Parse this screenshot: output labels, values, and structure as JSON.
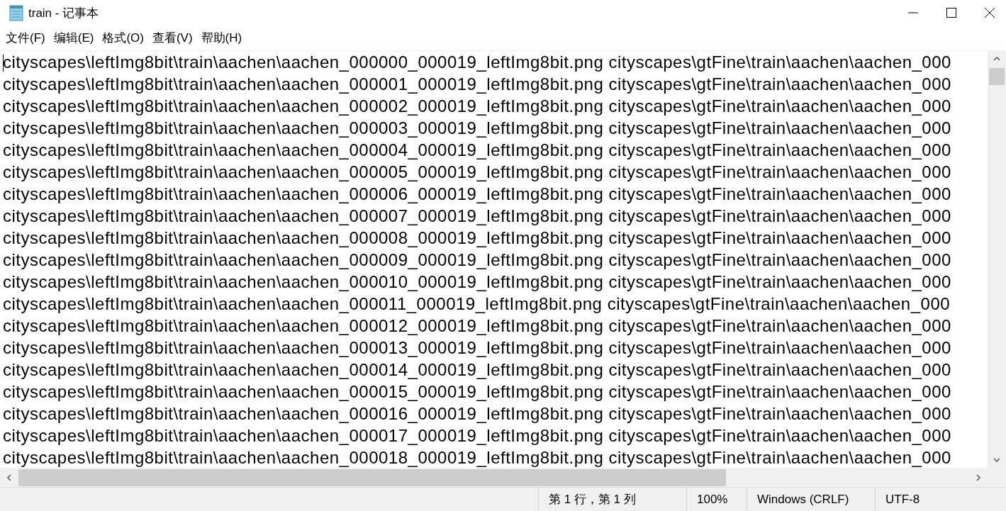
{
  "window": {
    "title": "train - 记事本"
  },
  "menu": [
    "文件(F)",
    "编辑(E)",
    "格式(O)",
    "查看(V)",
    "帮助(H)"
  ],
  "lines": [
    "cityscapes\\leftImg8bit\\train\\aachen\\aachen_000000_000019_leftImg8bit.png cityscapes\\gtFine\\train\\aachen\\aachen_000",
    "cityscapes\\leftImg8bit\\train\\aachen\\aachen_000001_000019_leftImg8bit.png cityscapes\\gtFine\\train\\aachen\\aachen_000",
    "cityscapes\\leftImg8bit\\train\\aachen\\aachen_000002_000019_leftImg8bit.png cityscapes\\gtFine\\train\\aachen\\aachen_000",
    "cityscapes\\leftImg8bit\\train\\aachen\\aachen_000003_000019_leftImg8bit.png cityscapes\\gtFine\\train\\aachen\\aachen_000",
    "cityscapes\\leftImg8bit\\train\\aachen\\aachen_000004_000019_leftImg8bit.png cityscapes\\gtFine\\train\\aachen\\aachen_000",
    "cityscapes\\leftImg8bit\\train\\aachen\\aachen_000005_000019_leftImg8bit.png cityscapes\\gtFine\\train\\aachen\\aachen_000",
    "cityscapes\\leftImg8bit\\train\\aachen\\aachen_000006_000019_leftImg8bit.png cityscapes\\gtFine\\train\\aachen\\aachen_000",
    "cityscapes\\leftImg8bit\\train\\aachen\\aachen_000007_000019_leftImg8bit.png cityscapes\\gtFine\\train\\aachen\\aachen_000",
    "cityscapes\\leftImg8bit\\train\\aachen\\aachen_000008_000019_leftImg8bit.png cityscapes\\gtFine\\train\\aachen\\aachen_000",
    "cityscapes\\leftImg8bit\\train\\aachen\\aachen_000009_000019_leftImg8bit.png cityscapes\\gtFine\\train\\aachen\\aachen_000",
    "cityscapes\\leftImg8bit\\train\\aachen\\aachen_000010_000019_leftImg8bit.png cityscapes\\gtFine\\train\\aachen\\aachen_000",
    "cityscapes\\leftImg8bit\\train\\aachen\\aachen_000011_000019_leftImg8bit.png cityscapes\\gtFine\\train\\aachen\\aachen_000",
    "cityscapes\\leftImg8bit\\train\\aachen\\aachen_000012_000019_leftImg8bit.png cityscapes\\gtFine\\train\\aachen\\aachen_000",
    "cityscapes\\leftImg8bit\\train\\aachen\\aachen_000013_000019_leftImg8bit.png cityscapes\\gtFine\\train\\aachen\\aachen_000",
    "cityscapes\\leftImg8bit\\train\\aachen\\aachen_000014_000019_leftImg8bit.png cityscapes\\gtFine\\train\\aachen\\aachen_000",
    "cityscapes\\leftImg8bit\\train\\aachen\\aachen_000015_000019_leftImg8bit.png cityscapes\\gtFine\\train\\aachen\\aachen_000",
    "cityscapes\\leftImg8bit\\train\\aachen\\aachen_000016_000019_leftImg8bit.png cityscapes\\gtFine\\train\\aachen\\aachen_000",
    "cityscapes\\leftImg8bit\\train\\aachen\\aachen_000017_000019_leftImg8bit.png cityscapes\\gtFine\\train\\aachen\\aachen_000",
    "cityscapes\\leftImg8bit\\train\\aachen\\aachen_000018_000019_leftImg8bit.png cityscapes\\gtFine\\train\\aachen\\aachen_000"
  ],
  "status_bar": {
    "position": "第 1 行，第 1 列",
    "zoom": "100%",
    "line_ending": "Windows (CRLF)",
    "encoding": "UTF-8"
  }
}
